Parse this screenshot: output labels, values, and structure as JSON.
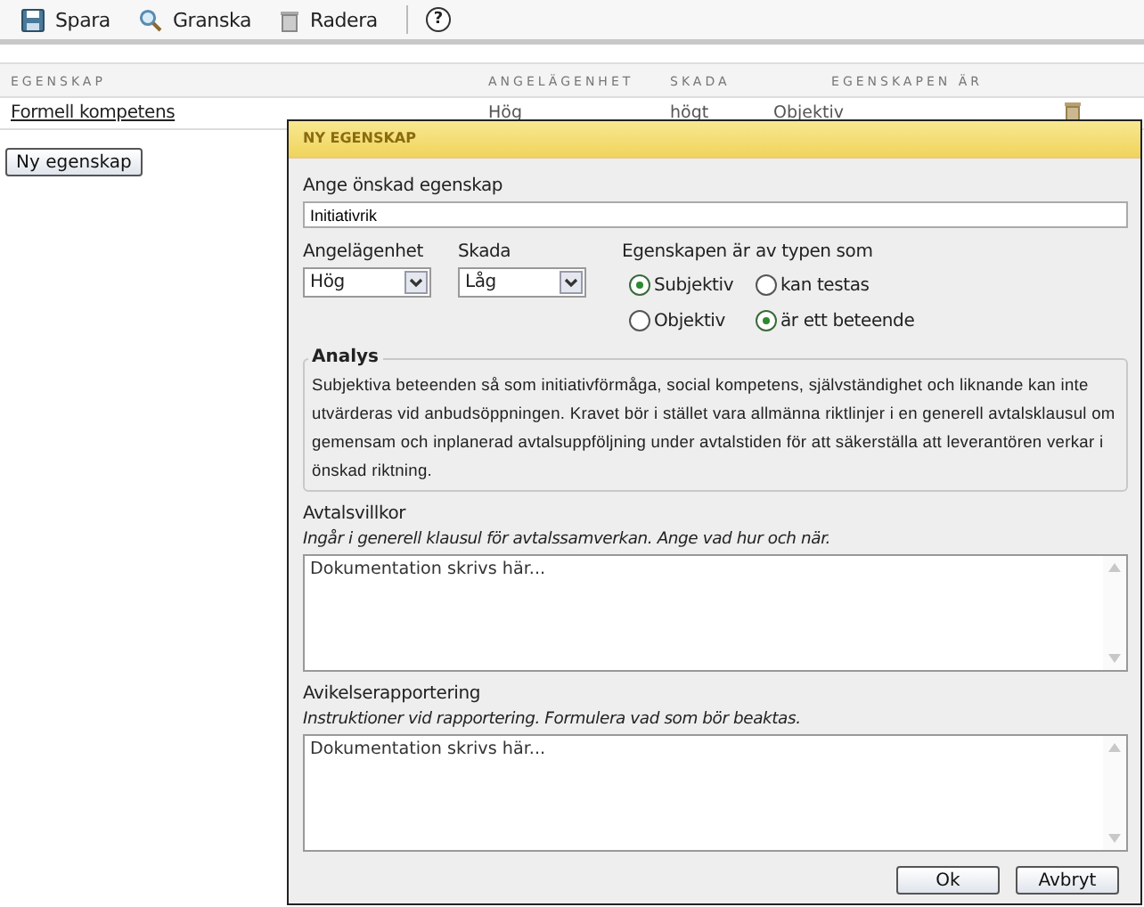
{
  "toolbar": [
    {
      "kind": "save",
      "label": "Spara"
    },
    {
      "kind": "search",
      "label": "Granska"
    },
    {
      "kind": "delete",
      "label": "Radera"
    },
    {
      "kind": "help",
      "label": "?"
    }
  ],
  "table": {
    "columns": [
      "EGENSKAP",
      "ANGELÄGENHET",
      "SKADA",
      "EGENSKAPEN ÄR"
    ],
    "rows": [
      {
        "cells": [
          "Formell kompetens",
          "Hög",
          "högt",
          "Objektiv"
        ]
      }
    ]
  },
  "add_button": "Ny egenskap",
  "dialog": {
    "title": "NY EGENSKAP",
    "name_label": "Ange önskad egenskap",
    "name_value": "Initiativrik",
    "selects": [
      {
        "label": "Angelägenhet",
        "value": "Hög"
      },
      {
        "label": "Skada",
        "value": "Låg"
      }
    ],
    "radio_groups": [
      {
        "label": "Egenskapen är",
        "options": [
          {
            "label": "Subjektiv",
            "selected": true
          },
          {
            "label": "Objektiv",
            "selected": false
          }
        ]
      },
      {
        "label": "av typen som",
        "options": [
          {
            "label": "kan testas",
            "selected": false
          },
          {
            "label": "är ett beteende",
            "selected": true
          }
        ]
      }
    ],
    "analysis": {
      "legend": "Analys",
      "text": "Subjektiva beteenden så som initiativförmåga, social kompetens, självständighet och liknande kan inte utvärderas vid anbudsöppningen. Kravet bör i stället vara allmänna riktlinjer i en generell avtalsklausul om gemensam och inplanerad avtalsuppföljning under avtalstiden för att säkerställa att leverantören verkar i önskad riktning."
    },
    "sections": [
      {
        "label": "Avtalsvillkor",
        "hint": "Ingår i generell klausul för avtalssamverkan. Ange vad hur och när.",
        "placeholder": "Dokumentation skrivs här..."
      },
      {
        "label": "Avikelserapportering",
        "hint": "Instruktioner vid rapportering. Formulera vad som bör beaktas.",
        "placeholder": "Dokumentation skrivs här..."
      }
    ],
    "buttons": [
      "Ok",
      "Avbryt"
    ]
  }
}
